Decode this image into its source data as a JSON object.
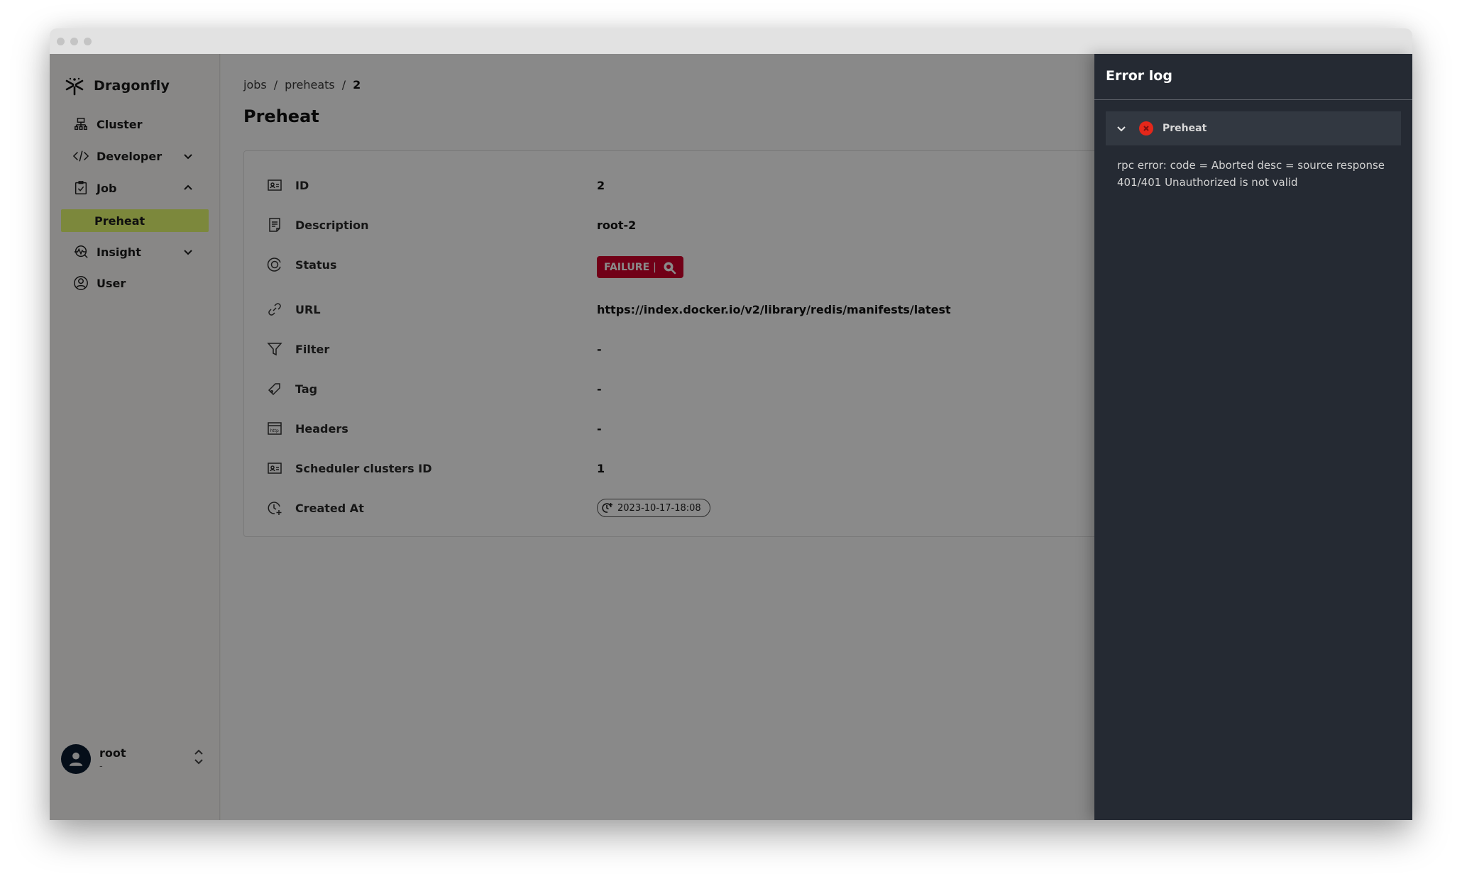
{
  "window": {
    "controls": [
      "close",
      "minimize",
      "maximize"
    ]
  },
  "sidebar": {
    "brand": "Dragonfly",
    "items": [
      {
        "label": "Cluster",
        "icon": "cluster-icon"
      },
      {
        "label": "Developer",
        "icon": "code-icon",
        "chevron": "down"
      },
      {
        "label": "Job",
        "icon": "clipboard-check-icon",
        "chevron": "up"
      },
      {
        "label": "Preheat",
        "sub": true,
        "active": true
      },
      {
        "label": "Insight",
        "icon": "insight-icon",
        "chevron": "down"
      },
      {
        "label": "User",
        "icon": "user-circle-icon"
      }
    ],
    "user": {
      "name": "root",
      "subtitle": "-"
    }
  },
  "breadcrumb": {
    "items": [
      "jobs",
      "preheats",
      "2"
    ],
    "separator": "/"
  },
  "page": {
    "title": "Preheat",
    "details": [
      {
        "key": "ID",
        "value": "2",
        "icon": "id-card-icon"
      },
      {
        "key": "Description",
        "value": "root-2",
        "icon": "document-icon"
      },
      {
        "key": "Status",
        "value": "FAILURE",
        "icon": "status-icon"
      },
      {
        "key": "URL",
        "value": "https://index.docker.io/v2/library/redis/manifests/latest",
        "icon": "link-icon"
      },
      {
        "key": "Filter",
        "value": "-",
        "icon": "filter-icon"
      },
      {
        "key": "Tag",
        "value": "-",
        "icon": "tag-icon"
      },
      {
        "key": "Headers",
        "value": "-",
        "icon": "http-icon"
      },
      {
        "key": "Scheduler clusters ID",
        "value": "1",
        "icon": "id-card-icon"
      },
      {
        "key": "Created At",
        "value": "2023-10-17-18:08",
        "icon": "clock-plus-icon"
      }
    ],
    "status_badge": {
      "label": "FAILURE",
      "separator": "|",
      "color": "#d1002b"
    }
  },
  "error_log": {
    "title": "Error log",
    "entries": [
      {
        "title": "Preheat",
        "expanded": true,
        "message": "rpc error: code = Aborted desc = source response 401/401 Unauthorized is not valid"
      }
    ]
  },
  "colors": {
    "accent": "#e6fb6f",
    "failure": "#d1002b",
    "error_icon": "#e5271a",
    "drawer_bg": "#252a33"
  }
}
